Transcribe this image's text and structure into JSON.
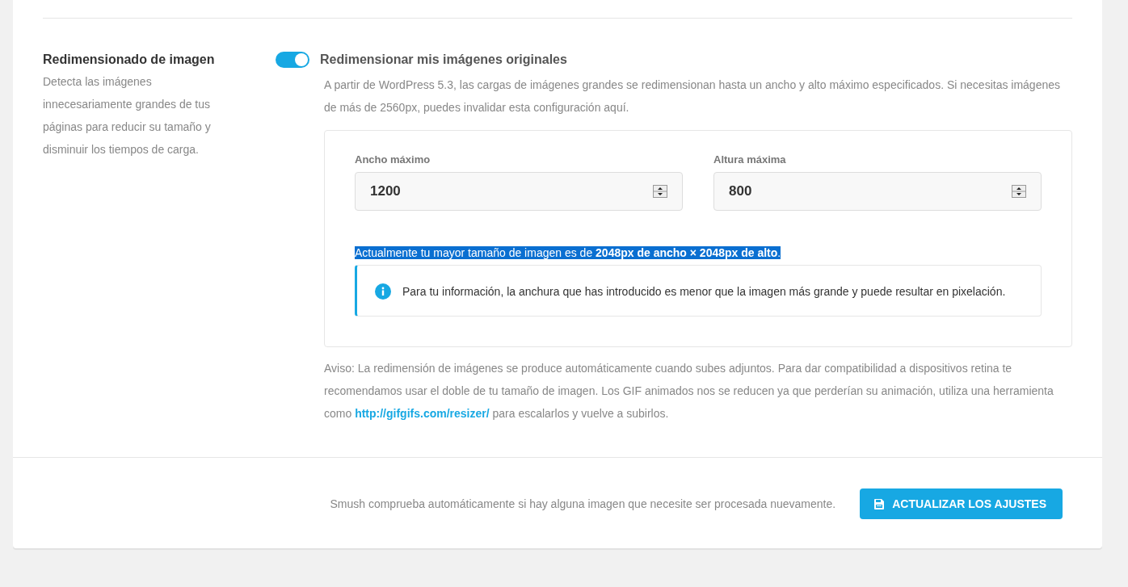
{
  "setting": {
    "title": "Redimensionado de imagen",
    "description": "Detecta las imágenes innecesariamente grandes de tus páginas para reducir su tamaño y disminuir los tiempos de carga."
  },
  "toggle": {
    "label": "Redimensionar mis imágenes originales",
    "on": true
  },
  "intro": "A partir de WordPress 5.3, las cargas de imágenes grandes se redimensionan hasta un ancho y alto máximo especificados. Si necesitas imágenes de más de 2560px, puedes invalidar esta configuración aquí.",
  "fields": [
    {
      "label": "Ancho máximo",
      "value": "1200"
    },
    {
      "label": "Altura máxima",
      "value": "800"
    }
  ],
  "current_size": {
    "text": "Actualmente tu mayor tamaño de imagen es de **2048px de ancho × 2048px de alto**.",
    "selected": true
  },
  "notice": "Para tu información, la anchura que has introducido es menor que la imagen más grande y puede resultar en pixelación.",
  "warning": {
    "before": "Aviso: La redimensión de imágenes se produce automáticamente cuando subes adjuntos. Para dar compatibilidad a dispositivos retina te recomendamos usar el doble de tu tamaño de imagen. Los GIF animados nos se reducen ya que perderían su animación, utiliza una herramienta como ",
    "link": "http://gifgifs.com/resizer/",
    "after": " para escalarlos y vuelve a subirlos."
  },
  "footer": {
    "text": "Smush comprueba automáticamente si hay alguna imagen que necesite ser procesada nuevamente.",
    "button": "ACTUALIZAR LOS AJUSTES"
  }
}
